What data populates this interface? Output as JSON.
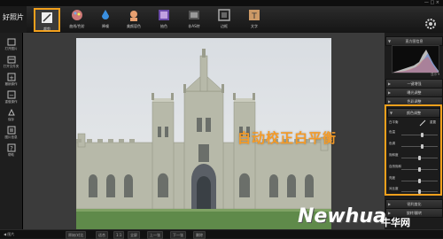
{
  "app": {
    "logo": "好照片",
    "window_controls": "— □ ×"
  },
  "toolbar": {
    "tools": [
      {
        "label": "裁剪",
        "icon": "crop-pencil-icon"
      },
      {
        "label": "曲线/色阶",
        "icon": "palette-icon"
      },
      {
        "label": "降噪",
        "icon": "drop-icon"
      },
      {
        "label": "美颜容色",
        "icon": "face-icon"
      },
      {
        "label": "抽色",
        "icon": "frame-icon"
      },
      {
        "label": "非AS特",
        "icon": "film-icon"
      },
      {
        "label": "边框",
        "icon": "border-icon"
      },
      {
        "label": "文字",
        "icon": "text-icon"
      }
    ],
    "settings_icon": "gear-icon"
  },
  "sidebar": {
    "items": [
      {
        "label": "打开图片",
        "icon": "folder-icon"
      },
      {
        "label": "打开文件夹",
        "icon": "folder-open-icon"
      },
      {
        "label": "撤销操作",
        "icon": "undo-icon"
      },
      {
        "label": "重做操作",
        "icon": "redo-icon"
      },
      {
        "label": "保存",
        "icon": "save-icon"
      },
      {
        "label": "图片信息",
        "icon": "info-icon"
      },
      {
        "label": "帮助",
        "icon": "help-icon"
      }
    ]
  },
  "overlay_text": "自动校正白平衡",
  "right_panel": {
    "histogram": {
      "title": "直方图信息",
      "hint": "显示 ▾"
    },
    "sections": [
      "一键增强",
      "曝光调整",
      "色彩调整"
    ],
    "wb_section": {
      "title": "颜色调整",
      "auto_label": "白平衡",
      "reset_label": "重置",
      "sliders": [
        {
          "label": "色温",
          "value": 0.58
        },
        {
          "label": "色调",
          "value": 0.58
        },
        {
          "label": "饱和度",
          "value": 0.5
        },
        {
          "label": "自然饱和",
          "value": 0.5
        },
        {
          "label": "亮度",
          "value": 0.5
        },
        {
          "label": "对比度",
          "value": 0.5
        }
      ]
    },
    "after": [
      "锐利度化",
      "旋转/翻转"
    ]
  },
  "statusbar": {
    "left": "◀ 图片",
    "items": [
      "原始/对比",
      "适合",
      "1:1",
      "全屏",
      "上一张",
      "下一张",
      "删除"
    ]
  },
  "watermark": {
    "brand": "Newhua",
    "cn": "牛华网"
  },
  "colors": {
    "accent": "#f2a01c",
    "overlay": "#f49a26"
  }
}
